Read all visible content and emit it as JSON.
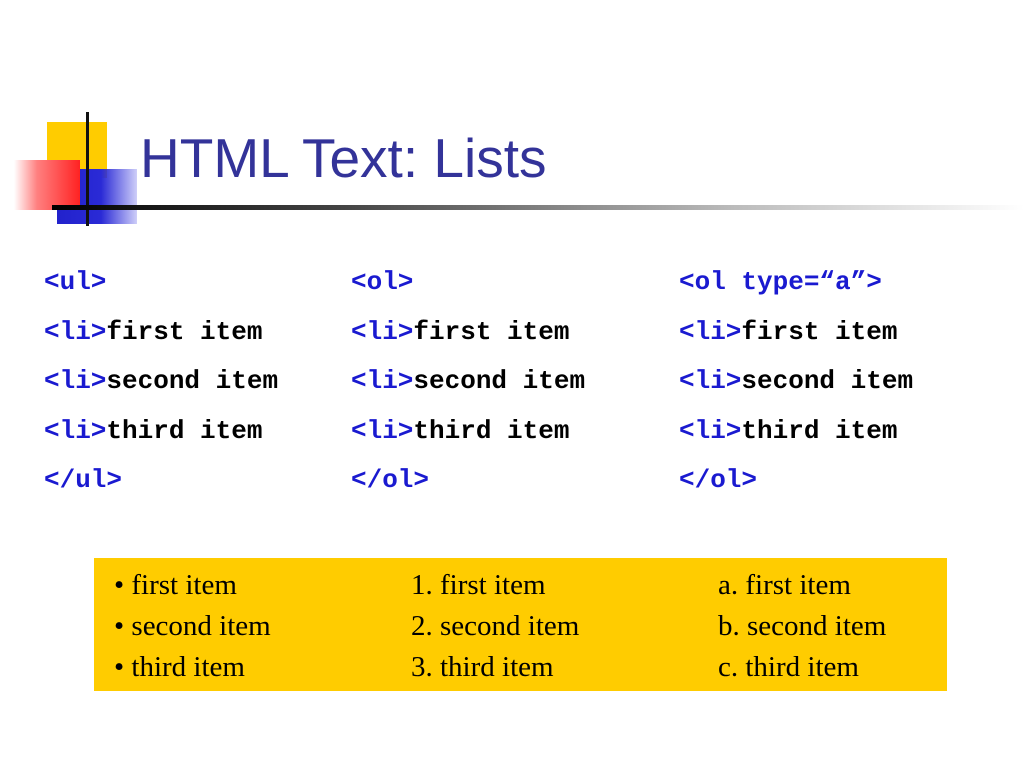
{
  "slide": {
    "title": "HTML Text: Lists"
  },
  "code_columns": [
    {
      "open_tag": "<ul>",
      "items": [
        {
          "tag": "<li>",
          "text": "first item"
        },
        {
          "tag": "<li>",
          "text": "second item"
        },
        {
          "tag": "<li>",
          "text": "third item"
        }
      ],
      "close_tag": "</ul>"
    },
    {
      "open_tag": "<ol>",
      "items": [
        {
          "tag": "<li>",
          "text": "first item"
        },
        {
          "tag": "<li>",
          "text": "second item"
        },
        {
          "tag": "<li>",
          "text": "third item"
        }
      ],
      "close_tag": "</ol>"
    },
    {
      "open_tag": "<ol type=“a”>",
      "items": [
        {
          "tag": "<li>",
          "text": "first item"
        },
        {
          "tag": "<li>",
          "text": "second item"
        },
        {
          "tag": "<li>",
          "text": "third item"
        }
      ],
      "close_tag": "</ol>"
    }
  ],
  "rendered_lists": [
    [
      "• first item",
      "• second item",
      "• third item"
    ],
    [
      "1. first item",
      "2. second item",
      "3. third item"
    ],
    [
      "a. first item",
      "b. second item",
      "c. third item"
    ]
  ],
  "colors": {
    "title": "#333399",
    "tag": "#1a1ad0",
    "result_box": "#ffcc00",
    "logo_yellow": "#ffcc00",
    "logo_blue": "#2222cc",
    "logo_red": "#ff2222"
  }
}
